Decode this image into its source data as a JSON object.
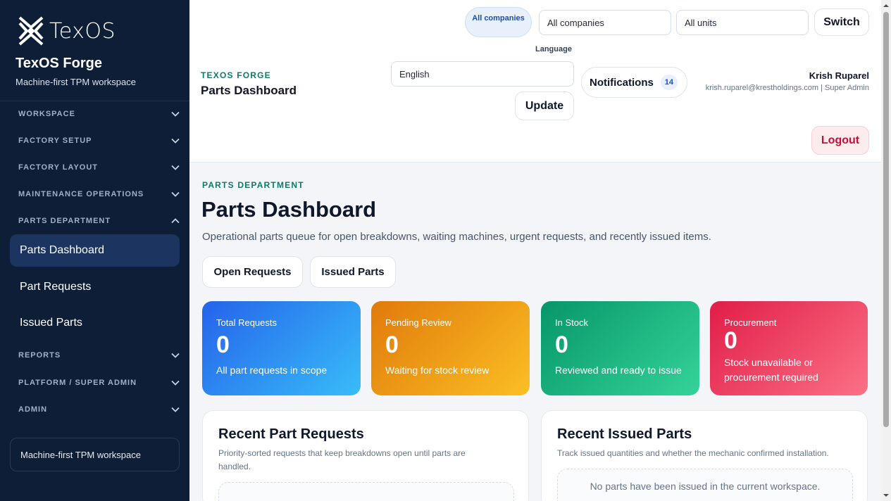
{
  "sidebar": {
    "logo_text": "TexOS",
    "brand_title": "TexOS Forge",
    "brand_subtitle": "Machine-first TPM workspace",
    "sections": {
      "workspace": "WORKSPACE",
      "factory_setup": "FACTORY SETUP",
      "factory_layout": "FACTORY LAYOUT",
      "maintenance_operations": "MAINTENANCE OPERATIONS",
      "parts_department": "PARTS DEPARTMENT",
      "reports": "REPORTS",
      "platform_super_admin": "PLATFORM / SUPER ADMIN",
      "admin": "ADMIN"
    },
    "items": {
      "parts_dashboard": "Parts Dashboard",
      "part_requests": "Part Requests",
      "issued_parts": "Issued Parts"
    },
    "footer": "Machine-first TPM workspace"
  },
  "topbar": {
    "eyebrow": "TEXOS FORGE",
    "title": "Parts Dashboard",
    "scope_pill": "All companies",
    "company_select": "All companies",
    "unit_select": "All units",
    "switch_label": "Switch",
    "language_label": "Language",
    "language_value": "English",
    "update_label": "Update",
    "notifications_label": "Notifications",
    "notifications_count": "14",
    "user_name": "Krish Ruparel",
    "user_meta": "krish.ruparel@krestholdings.com | Super Admin",
    "logout_label": "Logout"
  },
  "main": {
    "eyebrow": "PARTS DEPARTMENT",
    "title": "Parts Dashboard",
    "lead": "Operational parts queue for open breakdowns, waiting machines, urgent requests, and recently issued items.",
    "tabs": [
      "Open Requests",
      "Issued Parts"
    ],
    "cards": [
      {
        "label": "Total Requests",
        "value": "0",
        "desc": "All part requests in scope"
      },
      {
        "label": "Pending Review",
        "value": "0",
        "desc": "Waiting for stock review"
      },
      {
        "label": "In Stock",
        "value": "0",
        "desc": "Reviewed and ready to issue"
      },
      {
        "label": "Procurement",
        "value": "0",
        "desc": "Stock unavailable or procurement required"
      }
    ],
    "recent_requests": {
      "title": "Recent Part Requests",
      "subtitle": "Priority-sorted requests that keep breakdowns open until parts are handled."
    },
    "recent_issued": {
      "title": "Recent Issued Parts",
      "subtitle": "Track issued quantities and whether the mechanic confirmed installation.",
      "empty": "No parts have been issued in the current workspace."
    }
  },
  "colors": {
    "sidebar_bg": "#0f1e37",
    "accent_teal": "#0e7a68",
    "blue": "#2563eb",
    "amber": "#e07a0b",
    "green": "#079669",
    "red": "#e11d48"
  }
}
